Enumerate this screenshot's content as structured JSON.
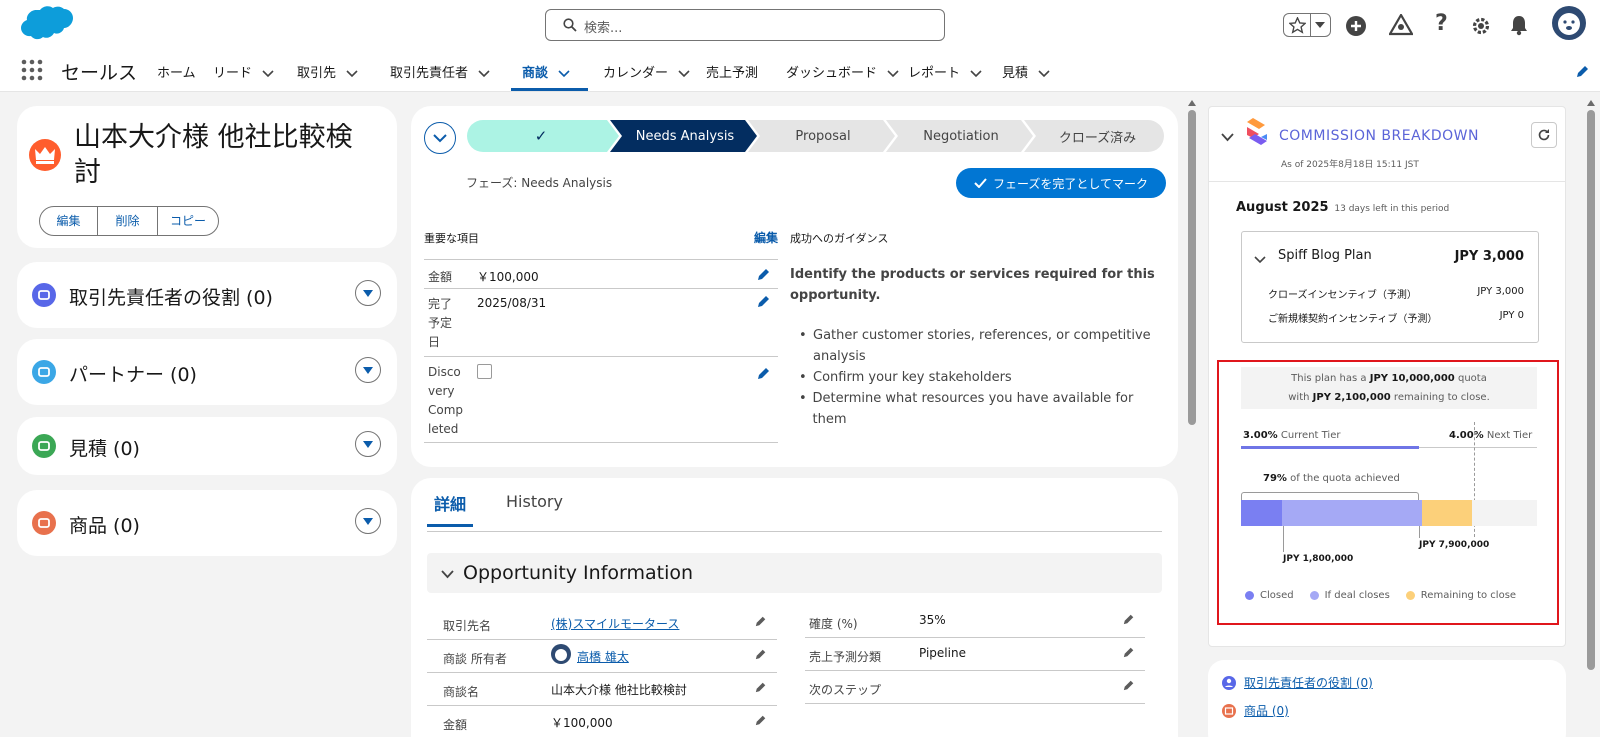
{
  "app": {
    "name": "セールス"
  },
  "search": {
    "placeholder": "検索..."
  },
  "nav": {
    "items": [
      {
        "label": "ホーム",
        "chevron": false
      },
      {
        "label": "リード",
        "chevron": true
      },
      {
        "label": "取引先",
        "chevron": true
      },
      {
        "label": "取引先責任者",
        "chevron": true
      },
      {
        "label": "商談",
        "chevron": true,
        "active": true
      },
      {
        "label": "カレンダー",
        "chevron": true
      },
      {
        "label": "売上予測",
        "chevron": false
      },
      {
        "label": "ダッシュボード",
        "chevron": true
      },
      {
        "label": "レポート",
        "chevron": true
      },
      {
        "label": "見積",
        "chevron": true
      }
    ]
  },
  "record": {
    "title_line1": "山本大介様 他社比較検",
    "title_line2": "討",
    "actions": [
      "編集",
      "削除",
      "コピー"
    ]
  },
  "related": [
    {
      "label": "取引先責任者の役割 (0)",
      "color": "#5867e8",
      "icon": "contact-role-icon"
    },
    {
      "label": "パートナー (0)",
      "color": "#3ba7e6",
      "icon": "partner-icon"
    },
    {
      "label": "見積 (0)",
      "color": "#3ba755",
      "icon": "quote-icon"
    },
    {
      "label": "商品 (0)",
      "color": "#e8714d",
      "icon": "product-icon"
    }
  ],
  "path": {
    "steps": [
      "✓",
      "Needs Analysis",
      "Proposal",
      "Negotiation",
      "クローズ済み"
    ],
    "phase_label": "フェーズ: Needs Analysis",
    "mark_button": "フェーズを完了としてマーク"
  },
  "key_fields": {
    "heading": "重要な項目",
    "edit": "編集",
    "rows": [
      {
        "label": "金額",
        "value": "￥100,000"
      },
      {
        "label": "完了予定日",
        "label_lines": [
          "完了",
          "予定",
          "日"
        ],
        "value": "2025/08/31"
      },
      {
        "label": "Discovery Completed",
        "label_lines": [
          "Disco",
          "very",
          "Comp",
          "leted"
        ],
        "value": ""
      }
    ]
  },
  "guidance": {
    "heading": "成功へのガイダンス",
    "bold_line1": "Identify the products or services required for this",
    "bold_line2": "opportunity.",
    "bullets": [
      {
        "l1": "Gather customer stories, references, or competitive",
        "l2": "analysis"
      },
      {
        "l1": "Confirm your key stakeholders",
        "l2": ""
      },
      {
        "l1": "Determine what resources you have available for them",
        "l2": ""
      }
    ]
  },
  "details": {
    "tabs": [
      "詳細",
      "History"
    ],
    "section": "Opportunity Information",
    "left": [
      {
        "label": "取引先名",
        "value": "(株)スマイルモータース",
        "link": true
      },
      {
        "label": "商談 所有者",
        "value": "高橋 雄太",
        "link": true
      },
      {
        "label": "商談名",
        "value": "山本大介様 他社比較検討",
        "link": false
      },
      {
        "label": "金額",
        "value": "￥100,000",
        "link": false
      }
    ],
    "right": [
      {
        "label": "確度 (%)",
        "value": "35%"
      },
      {
        "label": "売上予測分類",
        "value": "Pipeline"
      },
      {
        "label": "次のステップ",
        "value": ""
      }
    ]
  },
  "commission": {
    "title": "COMMISSION BREAKDOWN",
    "as_of": "As of 2025年8月18日 15:11 JST",
    "period": "August 2025",
    "days_left": "13 days left in this period",
    "plan": {
      "name": "Spiff Blog Plan",
      "amount": "JPY 3,000",
      "lines": [
        {
          "label": "クローズインセンティブ（予測）",
          "value": "JPY 3,000"
        },
        {
          "label": "ご新規様契約インセンティブ（予測）",
          "value": "JPY 0"
        }
      ]
    },
    "quota": {
      "prefix1": "This plan has a",
      "quota_amount": "JPY 10,000,000",
      "suffix1": "quota",
      "prefix2": "with",
      "remaining_amount": "JPY 2,100,000",
      "suffix2": "remaining to close."
    },
    "tiers": {
      "current_pct": "3.00%",
      "current_label": "Current Tier",
      "next_pct": "4.00%",
      "next_label": "Next Tier",
      "progress_to_next": 0.6
    },
    "achieved": {
      "pct": "79%",
      "text": "of the quota achieved"
    },
    "bar": {
      "closed_fraction": 0.14,
      "if_deal_closes_fraction": 0.47,
      "remaining_fraction": 0.17,
      "label_low": "JPY 1,800,000",
      "label_high": "JPY 7,900,000"
    },
    "legend": [
      {
        "label": "Closed",
        "color": "#7a7ff2"
      },
      {
        "label": "If deal closes",
        "color": "#a5a9f5"
      },
      {
        "label": "Remaining to close",
        "color": "#fcd07a"
      }
    ],
    "links": [
      {
        "label": "取引先責任者の役割 (0)",
        "color": "#5867e8"
      },
      {
        "label": "商品 (0)",
        "color": "#e8714d"
      }
    ]
  }
}
